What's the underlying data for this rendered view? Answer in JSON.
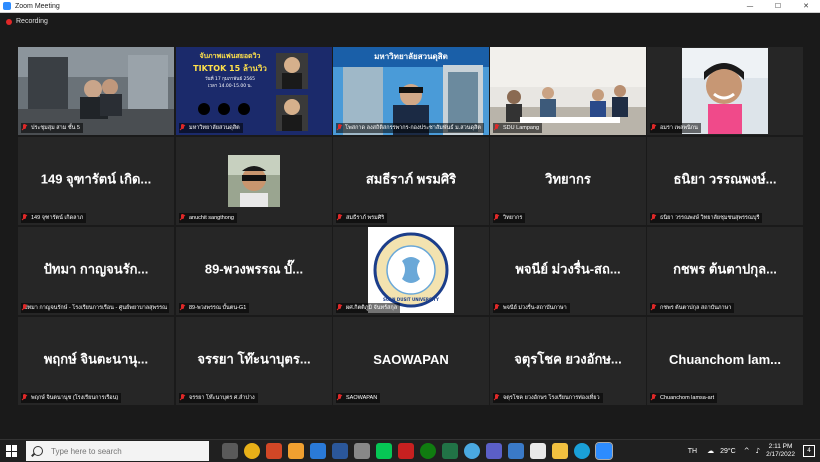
{
  "window": {
    "title": "Zoom Meeting",
    "minimize": "—",
    "maximize": "☐",
    "close": "✕"
  },
  "recording": {
    "label": "Recording"
  },
  "tiles": [
    {
      "name": "ประชุมสุม สาม ชั้น 5"
    },
    {
      "name": "มหาวิทยาลัยสวนดุสิต",
      "poster_title": "จับภาพแฟนสยอดวิว",
      "poster_sub": "TIKTOK 15 ล้านวิว",
      "poster_date": "วันที่ 17 กุมภาพันธ์ 2565",
      "poster_time": "เวลา 14.00-15.00 น."
    },
    {
      "name": "โพสกาด ลงสถิติสกรรพากร-กองประชาสัมพันธ์ ม.สวนดุสิต",
      "banner": "มหาวิทยาลัยสวนดุสิต"
    },
    {
      "name": "SDU Lampang"
    },
    {
      "name": "อมรา เพลพนิกน"
    },
    {
      "name": "149 จุฑารัตน์ เกิดลาภ",
      "big": "149 จุฑารัตน์ เกิด..."
    },
    {
      "name": "anuchit sangthong"
    },
    {
      "name": "สมธีราภ์ พรมศิริ",
      "big": "สมธีราภ์ พรมศิริ"
    },
    {
      "name": "วิทยากร",
      "big": "วิทยากร"
    },
    {
      "name": "ธนิยา วรรณพงษ์ วิทยาลัยชุมชนสุพรรณบุรี",
      "big": "ธนิยา วรรณพงษ์..."
    },
    {
      "name": "ปัทมา กาญจนรักษ์ - โรงเรียนการเรือน - ศูนย์พยาบาลสุพรรณ",
      "big": "ปัทมา กาญจนรัก..."
    },
    {
      "name": "89-พวงพรรณ บั้นตน-G1",
      "big": "89-พวงพรรณ บั๊..."
    },
    {
      "name": "ผศ.กิตติภูมิ จันทร์สกุล",
      "logo_text": "SUAN DUSIT UNIVERSITY"
    },
    {
      "name": "พจนีย์ ม่วงรื่น-สถาบันภาษา",
      "big": "พจนีย์ ม่วงรื่น-สถ..."
    },
    {
      "name": "กชพร ต้นตาปกุล สถาบันภาษา",
      "big": "กชพร ต้นตาปกุล..."
    },
    {
      "name": "พฤกษ์ จินตนานุช (โรงเรียนการเรือน)",
      "big": "พฤกษ์ จินตะนานุ..."
    },
    {
      "name": "จรรยา โท๊ะนาบุตร ศ.ลำปาง",
      "big": "จรรยา โท๊ะนาบุตร..."
    },
    {
      "name": "SAOWAPAN",
      "big": "SAOWAPAN"
    },
    {
      "name": "จตุรโชค ยวงอักษร โรงเรียนการท่องเที่ยว",
      "big": "จตุรโชค ยวงอักษ..."
    },
    {
      "name": "Chuanchom lamsa-art",
      "big": "Chuanchom lam..."
    }
  ],
  "taskbar": {
    "search_placeholder": "Type here to search",
    "lang": "TH",
    "temperature": "29°C",
    "time": "2:11 PM",
    "date": "2/17/2022",
    "notifications": "4"
  },
  "colors": {
    "active_border": "#e6e600",
    "mic_muted": "#e02828",
    "tile_bg": "#262626"
  }
}
